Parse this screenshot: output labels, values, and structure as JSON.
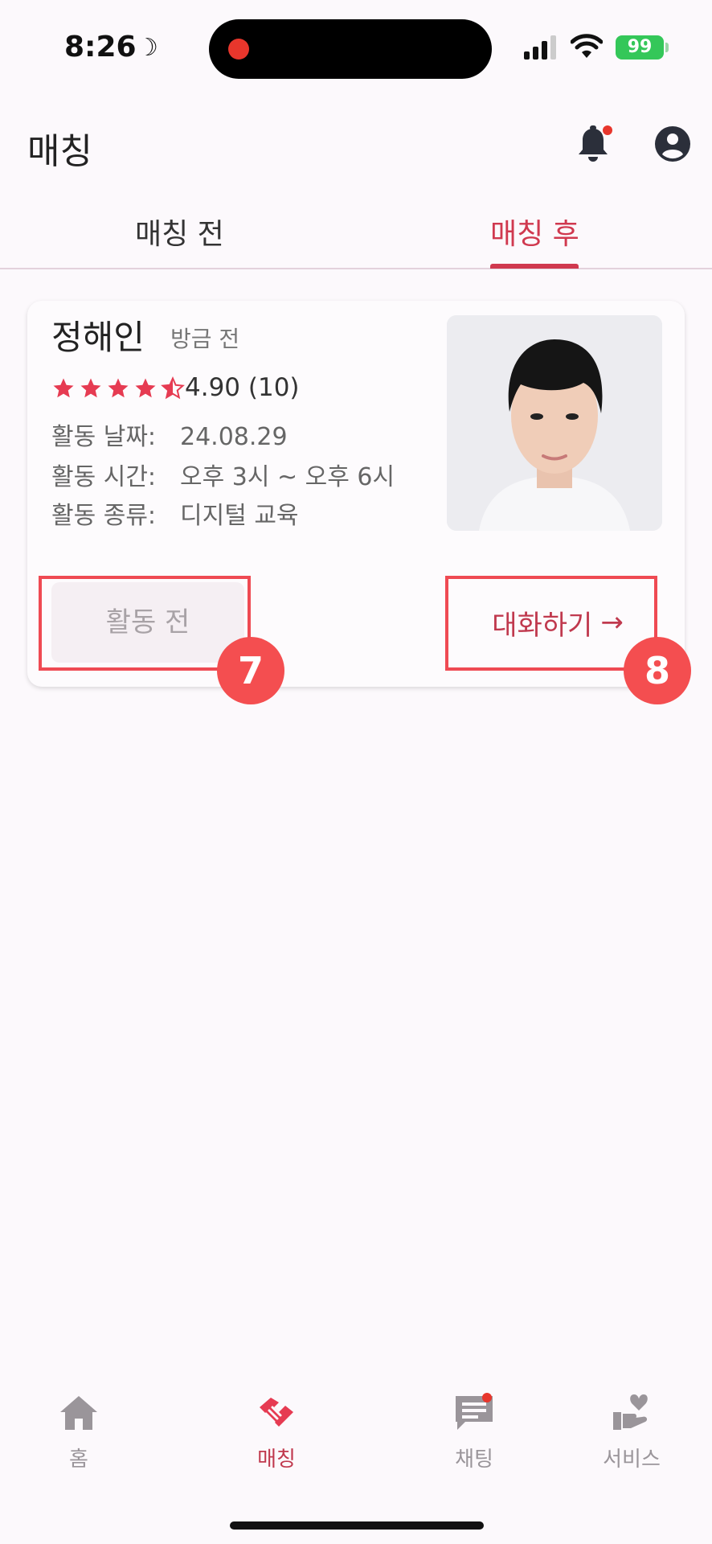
{
  "status_bar": {
    "time": "8:26",
    "battery": "99"
  },
  "header": {
    "title": "매칭"
  },
  "tabs": [
    {
      "label": "매칭 전",
      "active": false
    },
    {
      "label": "매칭 후",
      "active": true
    }
  ],
  "card": {
    "name": "정해인",
    "time_ago": "방금 전",
    "rating_text": "4.90 (10)",
    "rating_value": 4.5,
    "rating_max": 5,
    "info": [
      {
        "label": "활동 날짜:",
        "value": "24.08.29"
      },
      {
        "label": "활동 시간:",
        "value": "오후 3시 ~ 오후 6시"
      },
      {
        "label": "활동 종류:",
        "value": "디지털 교육"
      }
    ],
    "status_button": "활동 전",
    "chat_button": "대화하기",
    "chat_arrow": "→"
  },
  "annotations": {
    "badge_left": "7",
    "badge_right": "8"
  },
  "bottom_nav": [
    {
      "label": "홈",
      "icon": "home-icon"
    },
    {
      "label": "매칭",
      "icon": "handshake-icon",
      "active": true
    },
    {
      "label": "채팅",
      "icon": "chat-icon"
    },
    {
      "label": "서비스",
      "icon": "heart-hand-icon"
    }
  ],
  "colors": {
    "accent": "#d0394f",
    "highlight": "#f44e50",
    "background": "#fcf9fc",
    "battery": "#34c759"
  }
}
